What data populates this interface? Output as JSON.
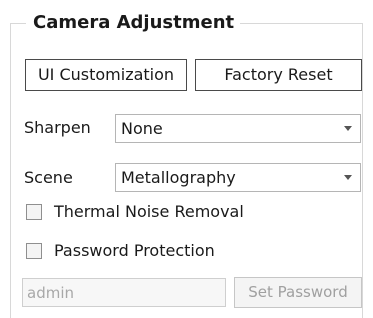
{
  "group": {
    "title": "Camera Adjustment"
  },
  "buttons": {
    "ui_customization": "UI Customization",
    "factory_reset": "Factory Reset"
  },
  "sharpen": {
    "label": "Sharpen",
    "value": "None"
  },
  "scene": {
    "label": "Scene",
    "value": "Metallography"
  },
  "thermal_noise_removal": {
    "label": "Thermal Noise Removal",
    "checked": false
  },
  "password_protection": {
    "label": "Password Protection",
    "checked": false,
    "input_value": "admin",
    "set_button": "Set Password",
    "enabled": false
  },
  "icons": {
    "combo_arrow": "chevron-down-icon",
    "checkbox": "checkbox-unchecked-icon"
  },
  "colors": {
    "disabled_text": "#a0a0a0",
    "frame_border": "#d8d8d8"
  }
}
